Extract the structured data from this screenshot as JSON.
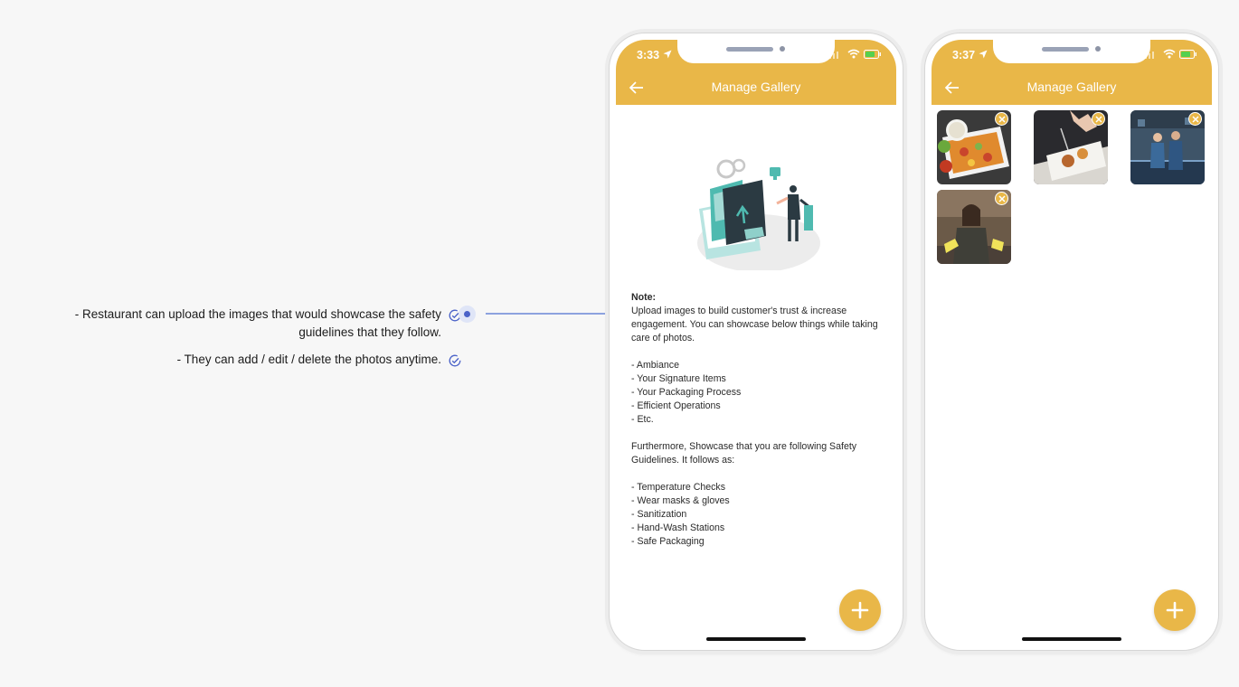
{
  "annotations": {
    "items": [
      "- Restaurant can upload the images that would showcase the safety guidelines that they follow.",
      "- They can add / edit / delete the photos anytime."
    ]
  },
  "phone1": {
    "time": "3:33",
    "title": "Manage Gallery",
    "note_heading": "Note:",
    "intro": "Upload images to build customer's trust & increase engagement. You can showcase below things while taking care of photos.",
    "showcase_items": [
      "- Ambiance",
      "- Your Signature Items",
      "- Your Packaging Process",
      "- Efficient Operations",
      "- Etc."
    ],
    "safety_intro": "Furthermore, Showcase that you are following Safety Guidelines. It follows as:",
    "safety_items": [
      "- Temperature Checks",
      "- Wear masks & gloves",
      "- Sanitization",
      "- Hand-Wash Stations",
      "- Safe Packaging"
    ]
  },
  "phone2": {
    "time": "3:37",
    "title": "Manage Gallery",
    "photos": [
      "food-box-photo",
      "plating-photo",
      "staff-photo",
      "chef-photo"
    ]
  },
  "colors": {
    "accent": "#e9b748",
    "annotation_blue": "#4a62c8"
  }
}
